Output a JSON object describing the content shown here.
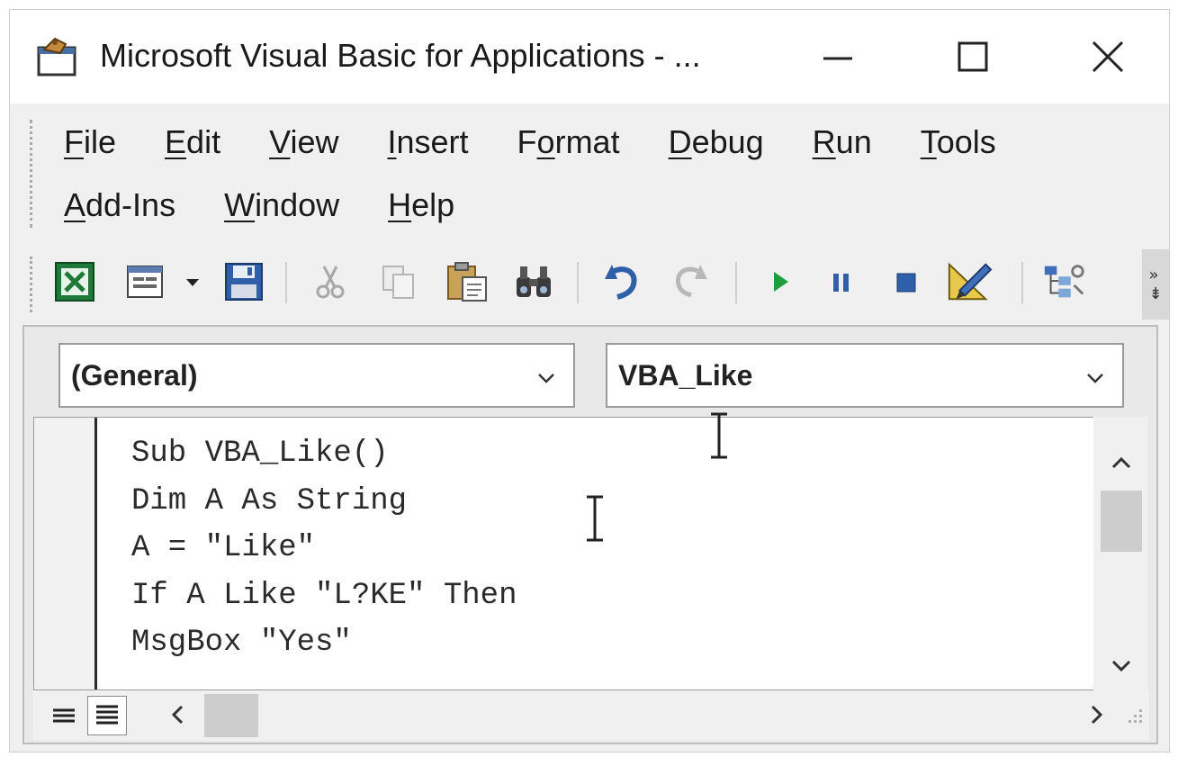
{
  "window": {
    "title": "Microsoft Visual Basic for Applications - ...",
    "icons": [
      "vba-app-icon",
      "minimize-icon",
      "maximize-icon",
      "close-icon"
    ]
  },
  "menu": {
    "row1": [
      {
        "label": "File",
        "underline_index": 0
      },
      {
        "label": "Edit",
        "underline_index": 0
      },
      {
        "label": "View",
        "underline_index": 0
      },
      {
        "label": "Insert",
        "underline_index": 0
      },
      {
        "label": "Format",
        "underline_index": 1
      },
      {
        "label": "Debug",
        "underline_index": 0
      },
      {
        "label": "Run",
        "underline_index": 0
      },
      {
        "label": "Tools",
        "underline_index": 0
      }
    ],
    "row2": [
      {
        "label": "Add-Ins",
        "underline_index": 0
      },
      {
        "label": "Window",
        "underline_index": 0
      },
      {
        "label": "Help",
        "underline_index": 0
      }
    ]
  },
  "toolbar": {
    "buttons": [
      "view-excel-icon",
      "insert-userform-icon",
      "dropdown-arrow-icon",
      "save-icon",
      "cut-icon",
      "copy-icon",
      "paste-icon",
      "find-icon",
      "undo-icon",
      "redo-icon",
      "run-icon",
      "break-icon",
      "reset-icon",
      "design-mode-icon",
      "project-explorer-icon",
      "toolbar-options-icon"
    ]
  },
  "code_window": {
    "object_combo": "(General)",
    "procedure_combo": "VBA_Like",
    "lines": [
      "Sub VBA_Like()",
      "Dim A As String",
      "A = \"Like\"",
      "If A Like \"L?KE\" Then",
      "MsgBox \"Yes\""
    ]
  },
  "colors": {
    "window_bg": "#f0f0f0",
    "titlebar_bg": "#ffffff",
    "run_green": "#1e9e3a",
    "editor_bg": "#ffffff",
    "text": "#1a1a1a"
  }
}
